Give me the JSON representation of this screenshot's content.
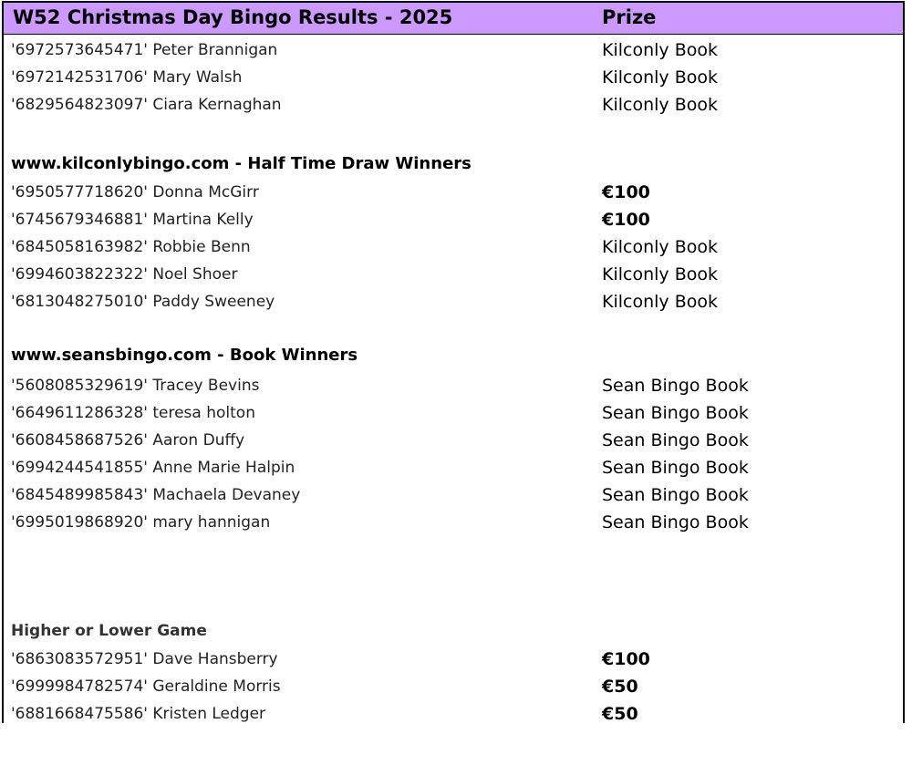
{
  "header": {
    "title": "W52 Christmas Day Bingo Results -  2025",
    "prize_label": "Prize"
  },
  "group1": [
    {
      "name": "'6972573645471' Peter Brannigan",
      "prize": "Kilconly Book"
    },
    {
      "name": "'6972142531706' Mary Walsh",
      "prize": "Kilconly Book"
    },
    {
      "name": "'6829564823097' Ciara Kernaghan",
      "prize": "Kilconly Book"
    }
  ],
  "section2": {
    "title": "www.kilconlybingo.com - Half Time Draw Winners",
    "rows": [
      {
        "name": "'6950577718620' Donna McGirr",
        "prize": "€100"
      },
      {
        "name": "'6745679346881' Martina Kelly",
        "prize": "€100"
      },
      {
        "name": "'6845058163982' Robbie Benn",
        "prize": "Kilconly Book"
      },
      {
        "name": "'6994603822322' Noel Shoer",
        "prize": "Kilconly Book"
      },
      {
        "name": "'6813048275010' Paddy Sweeney",
        "prize": "Kilconly Book"
      }
    ]
  },
  "section3": {
    "title": "www.seansbingo.com - Book Winners",
    "rows": [
      {
        "name": "'5608085329619' Tracey Bevins",
        "prize": "Sean Bingo Book"
      },
      {
        "name": "'6649611286328' teresa holton",
        "prize": "Sean Bingo Book"
      },
      {
        "name": "'6608458687526' Aaron Duffy",
        "prize": "Sean Bingo Book"
      },
      {
        "name": "'6994244541855' Anne Marie Halpin",
        "prize": "Sean Bingo Book"
      },
      {
        "name": "'6845489985843' Machaela Devaney",
        "prize": "Sean Bingo Book"
      },
      {
        "name": "'6995019868920' mary hannigan",
        "prize": "Sean Bingo Book"
      }
    ]
  },
  "section4": {
    "title": "Higher or Lower Game",
    "rows": [
      {
        "name": "'6863083572951' Dave Hansberry",
        "prize": "€100"
      },
      {
        "name": "'6999984782574' Geraldine Morris",
        "prize": "€50"
      },
      {
        "name": "'6881668475586' Kristen Ledger",
        "prize": "€50"
      }
    ]
  }
}
